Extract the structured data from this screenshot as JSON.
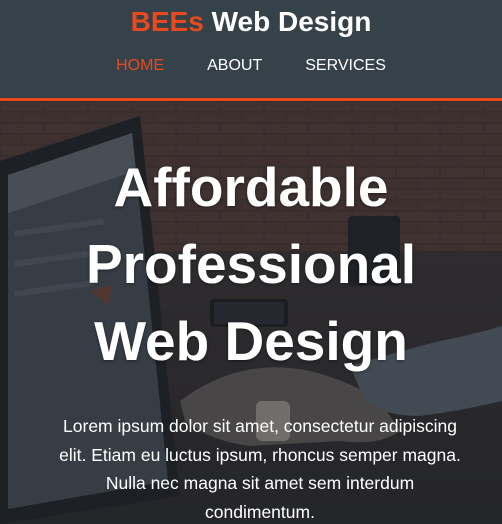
{
  "header": {
    "brand_accent": "BEEs",
    "brand_rest": " Web Design",
    "nav": [
      {
        "label": "HOME",
        "current": true
      },
      {
        "label": "ABOUT",
        "current": false
      },
      {
        "label": "SERVICES",
        "current": false
      }
    ]
  },
  "hero": {
    "heading": "Affordable Professional Web Design",
    "body": "Lorem ipsum dolor sit amet, consectetur adipiscing elit. Etiam eu luctus ipsum, rhoncus semper magna. Nulla nec magna sit amet sem interdum condimentum.",
    "background_image": "laptop-desk-photo"
  },
  "colors": {
    "header_bg": "#35424a",
    "accent": "#e8491d",
    "text": "#ffffff"
  }
}
